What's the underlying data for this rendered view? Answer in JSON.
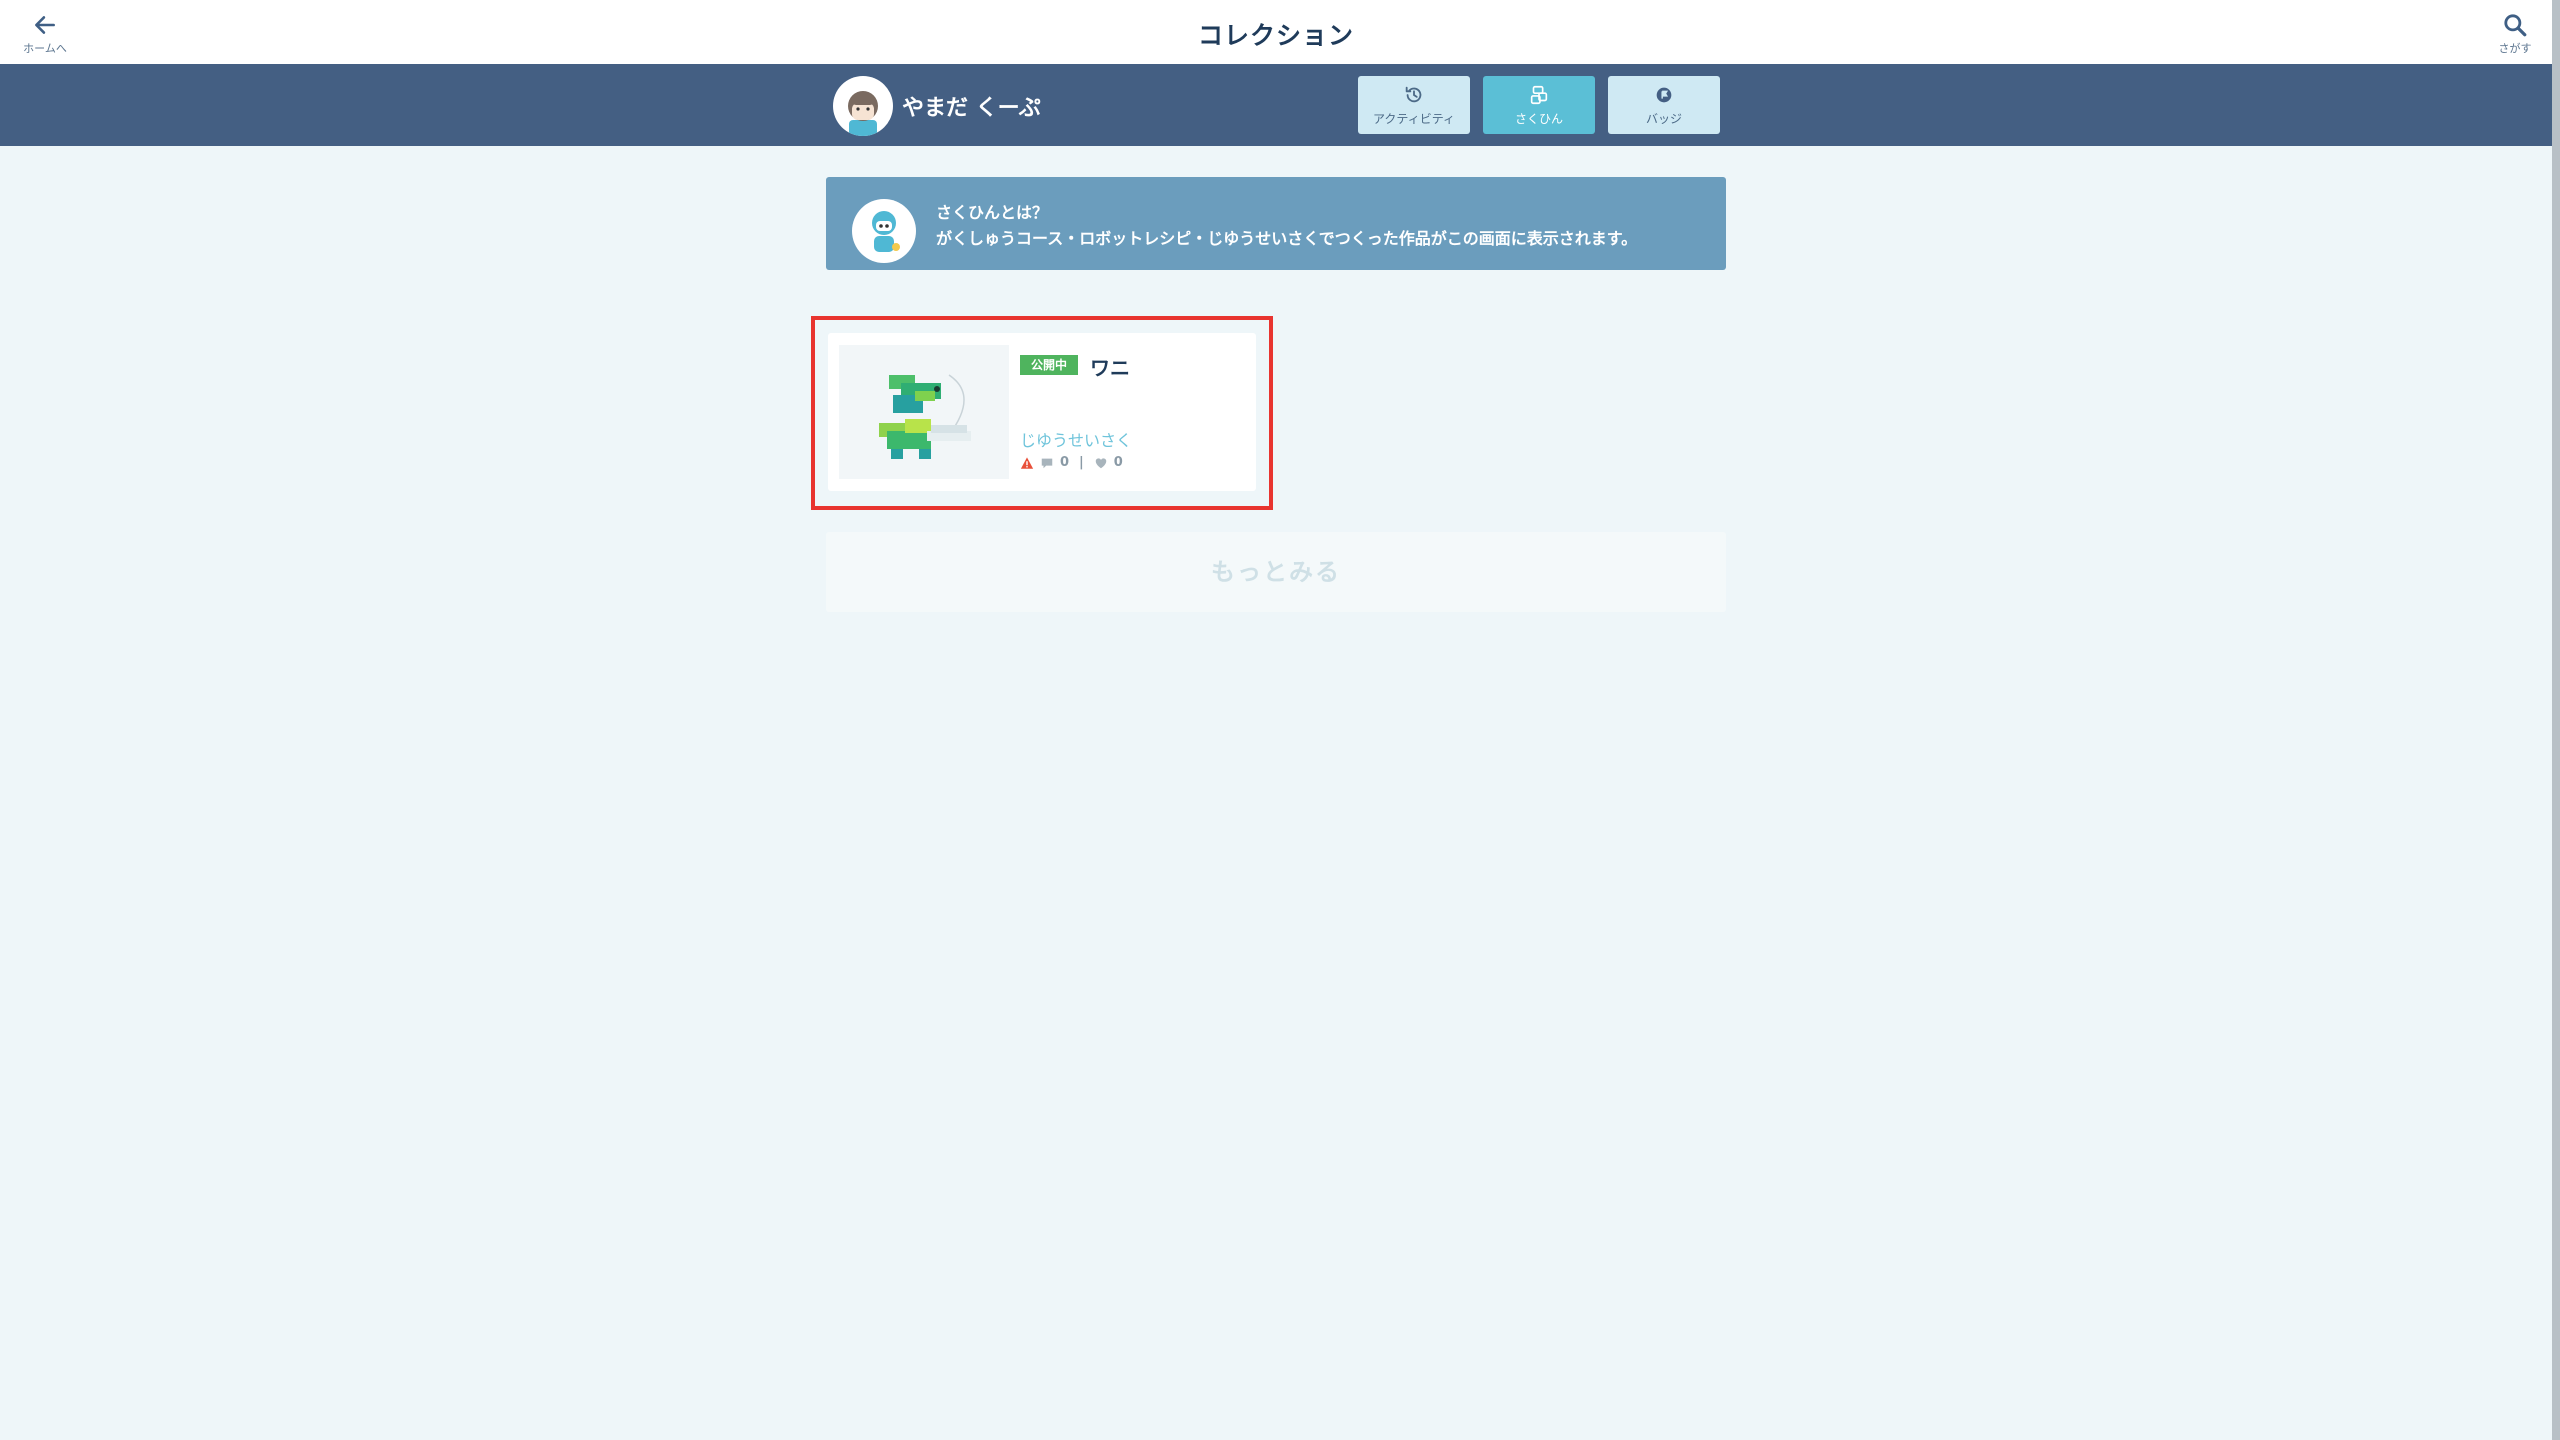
{
  "header": {
    "title": "コレクション",
    "back_label": "ホームへ",
    "search_label": "さがす"
  },
  "profile": {
    "user_name": "やまだ くーぷ",
    "tabs": [
      {
        "label": "アクティビティ",
        "icon": "history-icon",
        "active": false
      },
      {
        "label": "さくひん",
        "icon": "blocks-icon",
        "active": true
      },
      {
        "label": "バッジ",
        "icon": "badge-icon",
        "active": false
      }
    ]
  },
  "info_banner": {
    "title": "さくひんとは？",
    "text": "がくしゅうコース・ロボットレシピ・じゆうせいさくでつくった作品がこの画面に表示されます。"
  },
  "works": [
    {
      "status": "公開中",
      "title": "ワニ",
      "category": "じゆうせいさく",
      "comments": "0",
      "likes": "0",
      "thumbnail": "crocodile-robot-image"
    }
  ],
  "more_label": "もっとみる",
  "colors": {
    "header_bg": "#ffffff",
    "profile_bar": "#445f83",
    "tab_active": "#5bbfd6",
    "tab_inactive": "#cfe9f3",
    "banner": "#6b9dbd",
    "status_green": "#4fb45e",
    "highlight_red": "#e8342f"
  }
}
